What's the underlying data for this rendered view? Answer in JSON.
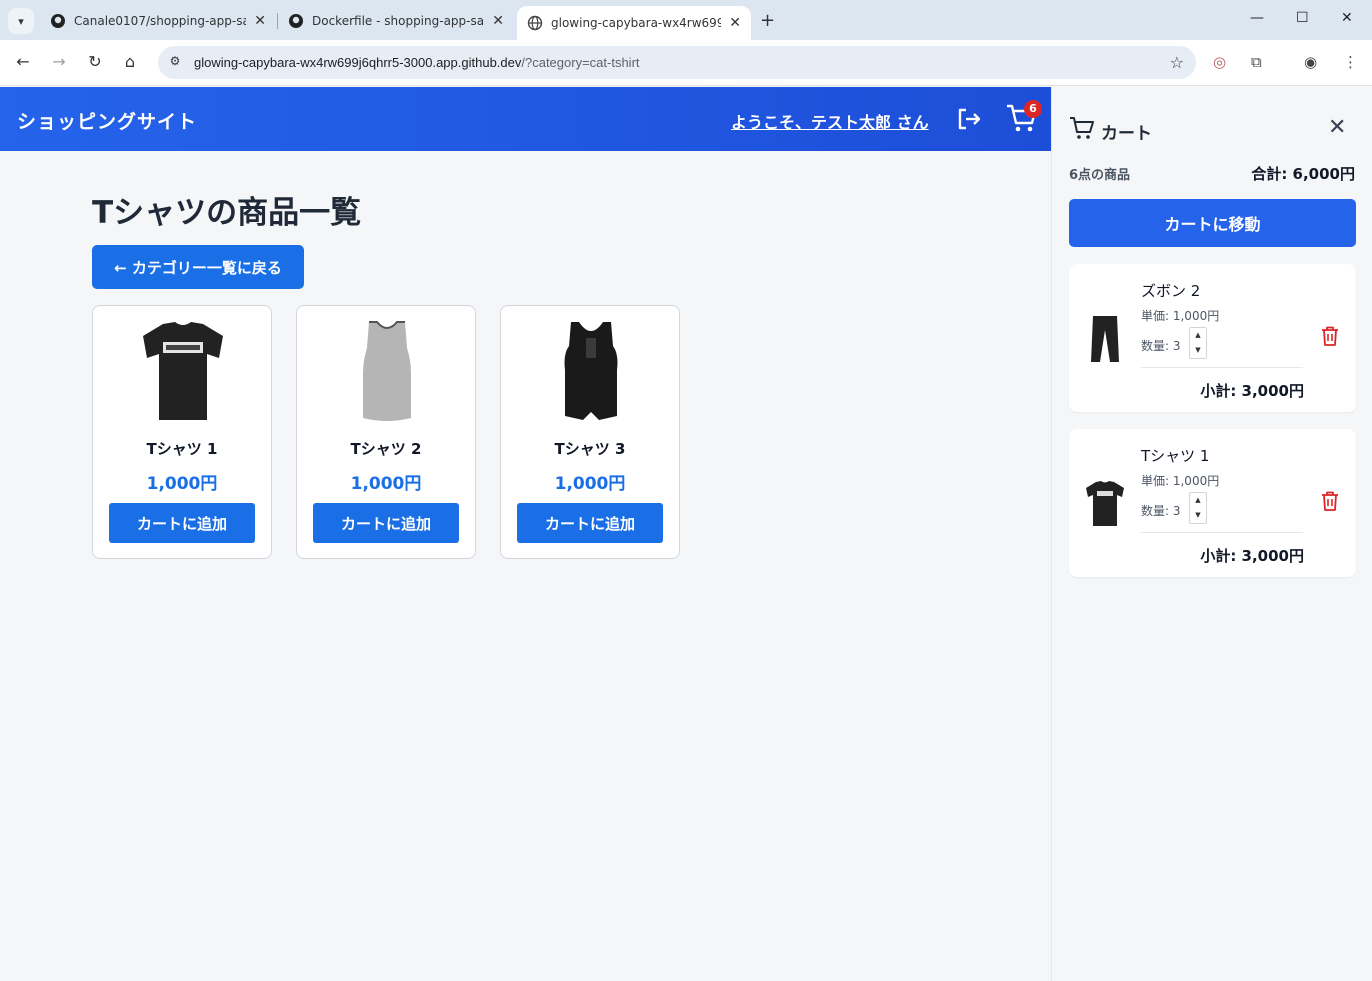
{
  "browser": {
    "tabs": [
      {
        "label": "Canale0107/shopping-app-sam",
        "icon": "github-icon"
      },
      {
        "label": "Dockerfile - shopping-app-sam",
        "icon": "github-icon"
      },
      {
        "label": "glowing-capybara-wx4rw699j6c",
        "icon": "globe-icon",
        "active": true
      }
    ],
    "url_host": "glowing-capybara-wx4rw699j6qhrr5-3000.app.github.dev",
    "url_path": "/?category=cat-tshirt"
  },
  "header": {
    "site_title": "ショッピングサイト",
    "welcome": "ようこそ、テスト太郎 さん",
    "cart_badge": "6"
  },
  "main": {
    "title": "Tシャツの商品一覧",
    "back_label": "← カテゴリー一覧に戻る",
    "products": [
      {
        "name": "Tシャツ 1",
        "price": "1,000円",
        "add_label": "カートに追加",
        "image": "black-tshirt"
      },
      {
        "name": "Tシャツ 2",
        "price": "1,000円",
        "add_label": "カートに追加",
        "image": "gray-tank-top"
      },
      {
        "name": "Tシャツ 3",
        "price": "1,000円",
        "add_label": "カートに追加",
        "image": "black-tank-top"
      }
    ]
  },
  "cart": {
    "title": "カート",
    "count": "6点の商品",
    "total": "合計: 6,000円",
    "goto_label": "カートに移動",
    "items": [
      {
        "name": "ズボン 2",
        "unit": "単価: 1,000円",
        "qty": "数量: 3",
        "subtotal": "小計: 3,000円",
        "image": "black-pants"
      },
      {
        "name": "Tシャツ 1",
        "unit": "単価: 1,000円",
        "qty": "数量: 3",
        "subtotal": "小計: 3,000円",
        "image": "black-tshirt"
      }
    ]
  },
  "colors": {
    "header": "#2563eb",
    "primary_button": "#1a6fe6",
    "badge": "#dc2626",
    "trash": "#dc2626"
  }
}
